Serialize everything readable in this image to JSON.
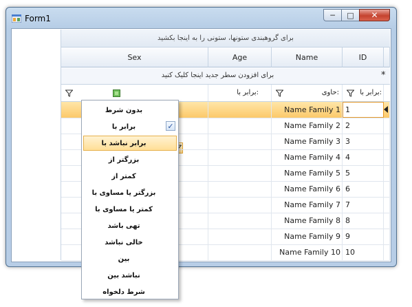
{
  "window": {
    "title": "Form1"
  },
  "grid": {
    "group_panel_text": "برای گروهبندی ستونها، ستونی را به اینجا بکشید",
    "columns": [
      "Sex",
      "Age",
      "Name",
      "ID"
    ],
    "new_row_text": "برای افزودن سطر جدید اینجا کلیک کنید",
    "new_row_marker": "*",
    "filter_labels": {
      "age": "برابر با:",
      "name": "حاوی:",
      "id": "برابر با:"
    },
    "rows": [
      {
        "name": "Name Family 1",
        "id": "1"
      },
      {
        "name": "Name Family 2",
        "id": "2"
      },
      {
        "name": "Name Family 3",
        "id": "3"
      },
      {
        "name": "Name Family 4",
        "id": "4"
      },
      {
        "name": "Name Family 5",
        "id": "5"
      },
      {
        "name": "Name Family 6",
        "id": "6"
      },
      {
        "name": "Name Family 7",
        "id": "7"
      },
      {
        "name": "Name Family 8",
        "id": "8"
      },
      {
        "name": "Name Family 9",
        "id": "9"
      },
      {
        "name": "Name Family 10",
        "id": "10"
      }
    ]
  },
  "filter_menu": {
    "items": [
      "بدون شرط",
      "برابر با",
      "برابر نباشد با",
      "بزرگتر از",
      "کمتر از",
      "بزرگتر یا مساوی با",
      "کمتر یا مساوی با",
      "تهی باشد",
      "خالی نباشد",
      "بین",
      "نباشد بین",
      "شرط دلخواه"
    ],
    "checked": "برابر با",
    "highlighted": "برابر نباشد با"
  },
  "colors": {
    "selection": "#fcc96a",
    "accent": "#e69a2b",
    "close": "#c5432f"
  },
  "icons": {
    "window": "window-icon",
    "filter": "funnel-icon",
    "boolean_filter": "checkbox-filter-icon",
    "current_row": "row-indicator-icon"
  }
}
